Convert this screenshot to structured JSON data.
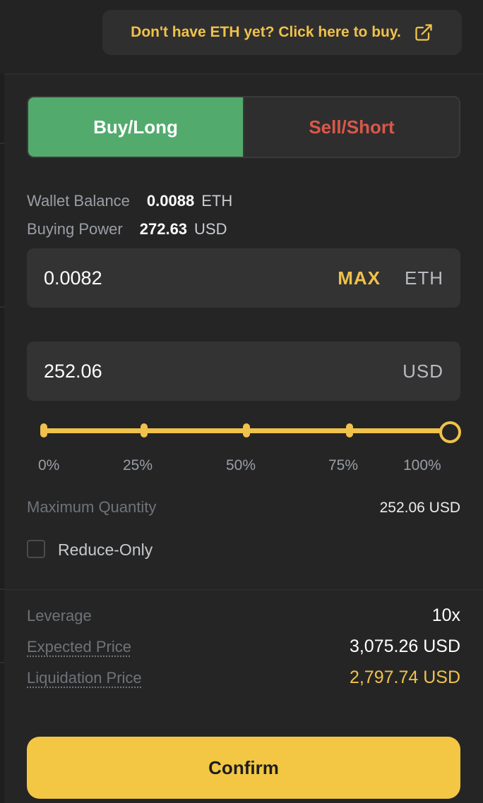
{
  "banner": {
    "text": "Don't have ETH yet? Click here to buy.",
    "icon": "external-link-icon"
  },
  "tabs": {
    "buy_label": "Buy/Long",
    "sell_label": "Sell/Short",
    "active": "buy"
  },
  "wallet": {
    "label": "Wallet Balance",
    "value": "0.0088",
    "unit": "ETH"
  },
  "buying_power": {
    "label": "Buying Power",
    "value": "272.63",
    "unit": "USD"
  },
  "amount_field": {
    "value": "0.0082",
    "max_label": "MAX",
    "unit": "ETH"
  },
  "usd_field": {
    "value": "252.06",
    "unit": "USD"
  },
  "slider": {
    "percent": 100,
    "ticks": [
      "0%",
      "25%",
      "50%",
      "75%",
      "100%"
    ]
  },
  "max_quantity": {
    "label": "Maximum Quantity",
    "value": "252.06 USD"
  },
  "reduce_only": {
    "label": "Reduce-Only",
    "checked": false
  },
  "leverage": {
    "label": "Leverage",
    "value": "10x"
  },
  "expected_price": {
    "label": "Expected Price",
    "value": "3,075.26 USD"
  },
  "liquidation_price": {
    "label": "Liquidation Price",
    "value": "2,797.74 USD"
  },
  "confirm_label": "Confirm",
  "colors": {
    "accent": "#f0c24b",
    "buy": "#52ab6d",
    "sell": "#d9584b",
    "background": "#252525"
  }
}
